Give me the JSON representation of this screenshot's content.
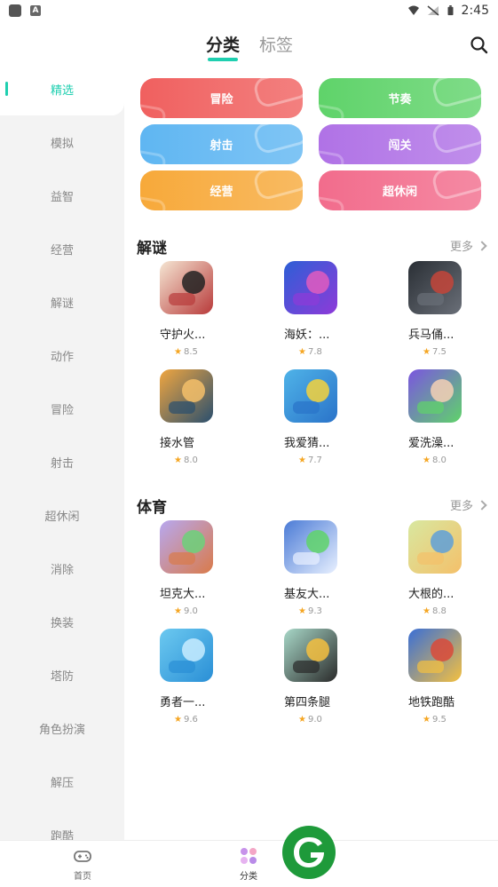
{
  "status": {
    "time": "2:45"
  },
  "header": {
    "tab_category": "分类",
    "tab_tags": "标签"
  },
  "sidebar": {
    "items": [
      {
        "label": "精选",
        "active": true
      },
      {
        "label": "模拟"
      },
      {
        "label": "益智"
      },
      {
        "label": "经营"
      },
      {
        "label": "解谜"
      },
      {
        "label": "动作"
      },
      {
        "label": "冒险"
      },
      {
        "label": "射击"
      },
      {
        "label": "超休闲"
      },
      {
        "label": "消除"
      },
      {
        "label": "换装"
      },
      {
        "label": "塔防"
      },
      {
        "label": "角色扮演"
      },
      {
        "label": "解压"
      },
      {
        "label": "跑酷"
      }
    ]
  },
  "categories": [
    {
      "label": "冒险",
      "color": "#f0605f"
    },
    {
      "label": "节奏",
      "color": "#5fd36a"
    },
    {
      "label": "射击",
      "color": "#5fb6f2"
    },
    {
      "label": "闯关",
      "color": "#b072e6"
    },
    {
      "label": "经营",
      "color": "#f7a93a"
    },
    {
      "label": "超休闲",
      "color": "#f26c8c"
    }
  ],
  "sections": [
    {
      "title": "解谜",
      "more": "更多",
      "games": [
        {
          "name": "守护火...",
          "score": "8.5",
          "icon": "stickman-icon"
        },
        {
          "name": "海妖：...",
          "score": "7.8",
          "icon": "sea-monster-icon"
        },
        {
          "name": "兵马俑...",
          "score": "7.5",
          "icon": "warrior-icon"
        },
        {
          "name": "接水管",
          "score": "8.0",
          "icon": "pipe-icon"
        },
        {
          "name": "我爱猜...",
          "score": "7.7",
          "icon": "word-puzzle-icon"
        },
        {
          "name": "爱洗澡...",
          "score": "8.0",
          "icon": "spray-icon"
        }
      ]
    },
    {
      "title": "体育",
      "more": "更多",
      "games": [
        {
          "name": "坦克大...",
          "score": "9.0",
          "icon": "muscle-man-icon"
        },
        {
          "name": "基友大...",
          "score": "9.3",
          "icon": "snowball-icon"
        },
        {
          "name": "大根的...",
          "score": "8.8",
          "icon": "kick-icon"
        },
        {
          "name": "勇者一...",
          "score": "9.6",
          "icon": "blue-crowd-icon"
        },
        {
          "name": "第四条腿",
          "score": "9.0",
          "icon": "robot-legs-icon"
        },
        {
          "name": "地铁跑酷",
          "score": "9.5",
          "icon": "subway-icon"
        }
      ]
    }
  ],
  "bottom_nav": {
    "home": "首页",
    "category": "分类"
  }
}
